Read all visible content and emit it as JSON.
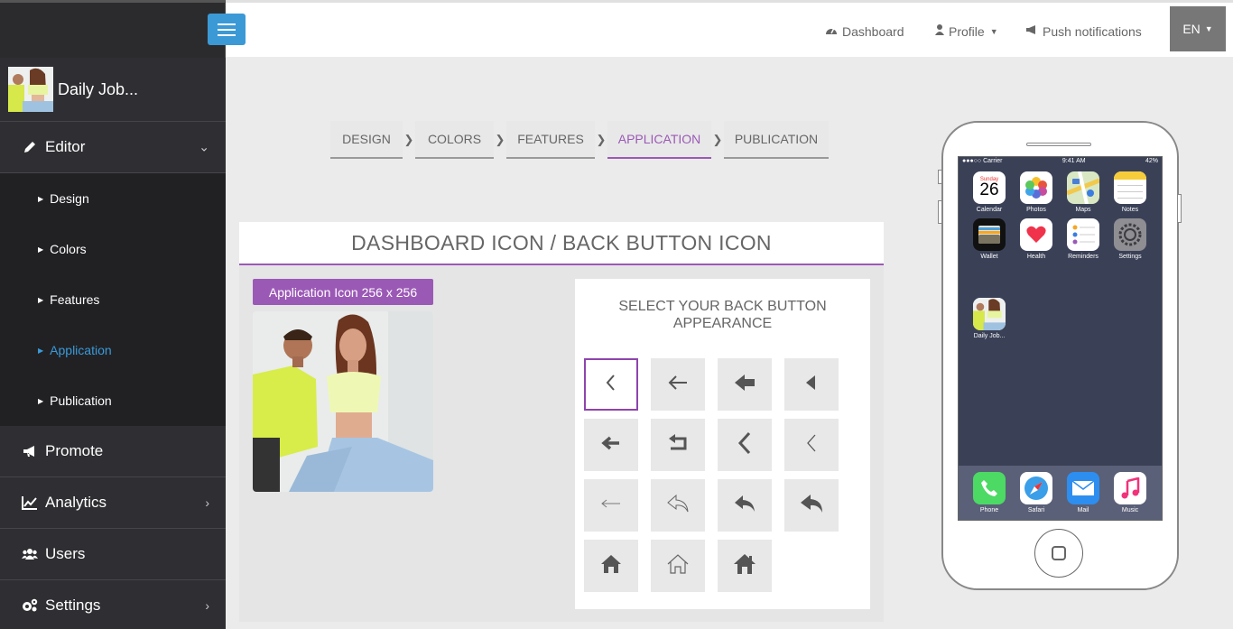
{
  "sidebar": {
    "app_name": "Daily Job...",
    "items": [
      {
        "label": "Editor",
        "icon": "pencil-icon"
      },
      {
        "label": "Promote",
        "icon": "bullhorn-icon"
      },
      {
        "label": "Analytics",
        "icon": "chart-icon"
      },
      {
        "label": "Users",
        "icon": "users-icon"
      },
      {
        "label": "Settings",
        "icon": "gears-icon"
      }
    ],
    "submenu": [
      {
        "label": "Design"
      },
      {
        "label": "Colors"
      },
      {
        "label": "Features"
      },
      {
        "label": "Application",
        "active": true
      },
      {
        "label": "Publication"
      }
    ]
  },
  "topbar": {
    "dashboard": "Dashboard",
    "profile": "Profile",
    "push": "Push notifications",
    "lang": "EN"
  },
  "steps": [
    {
      "label": "DESIGN"
    },
    {
      "label": "COLORS"
    },
    {
      "label": "FEATURES"
    },
    {
      "label": "APPLICATION",
      "active": true
    },
    {
      "label": "PUBLICATION"
    }
  ],
  "panel": {
    "title": "DASHBOARD ICON / BACK BUTTON ICON",
    "app_icon_button": "Application Icon 256 x 256",
    "back_title": "SELECT YOUR BACK BUTTON APPEARANCE"
  },
  "back_buttons": [
    "chevron-left-thin-icon",
    "arrow-left-thin-icon",
    "arrow-left-bold-icon",
    "triangle-left-icon",
    "arrow-left-solid-icon",
    "return-box-icon",
    "chevron-left-bold-icon",
    "chevron-left-light-icon",
    "arrow-left-hairline-icon",
    "reply-outline-icon",
    "reply-icon",
    "reply-bold-icon",
    "home-solid-icon",
    "home-outline-icon",
    "home-bold-icon"
  ],
  "phone": {
    "carrier": "Carrier",
    "time": "9:41 AM",
    "battery": "42%",
    "calendar_day": "Sunday",
    "calendar_date": "26",
    "apps": [
      "Calendar",
      "Photos",
      "Maps",
      "Notes",
      "Wallet",
      "Health",
      "Reminders",
      "Settings",
      "Daily Job..."
    ],
    "dock": [
      "Phone",
      "Safari",
      "Mail",
      "Music"
    ]
  },
  "colors": {
    "accent": "#9b59b6",
    "blue": "#3b99d6",
    "sidebar": "#2f2f33"
  }
}
